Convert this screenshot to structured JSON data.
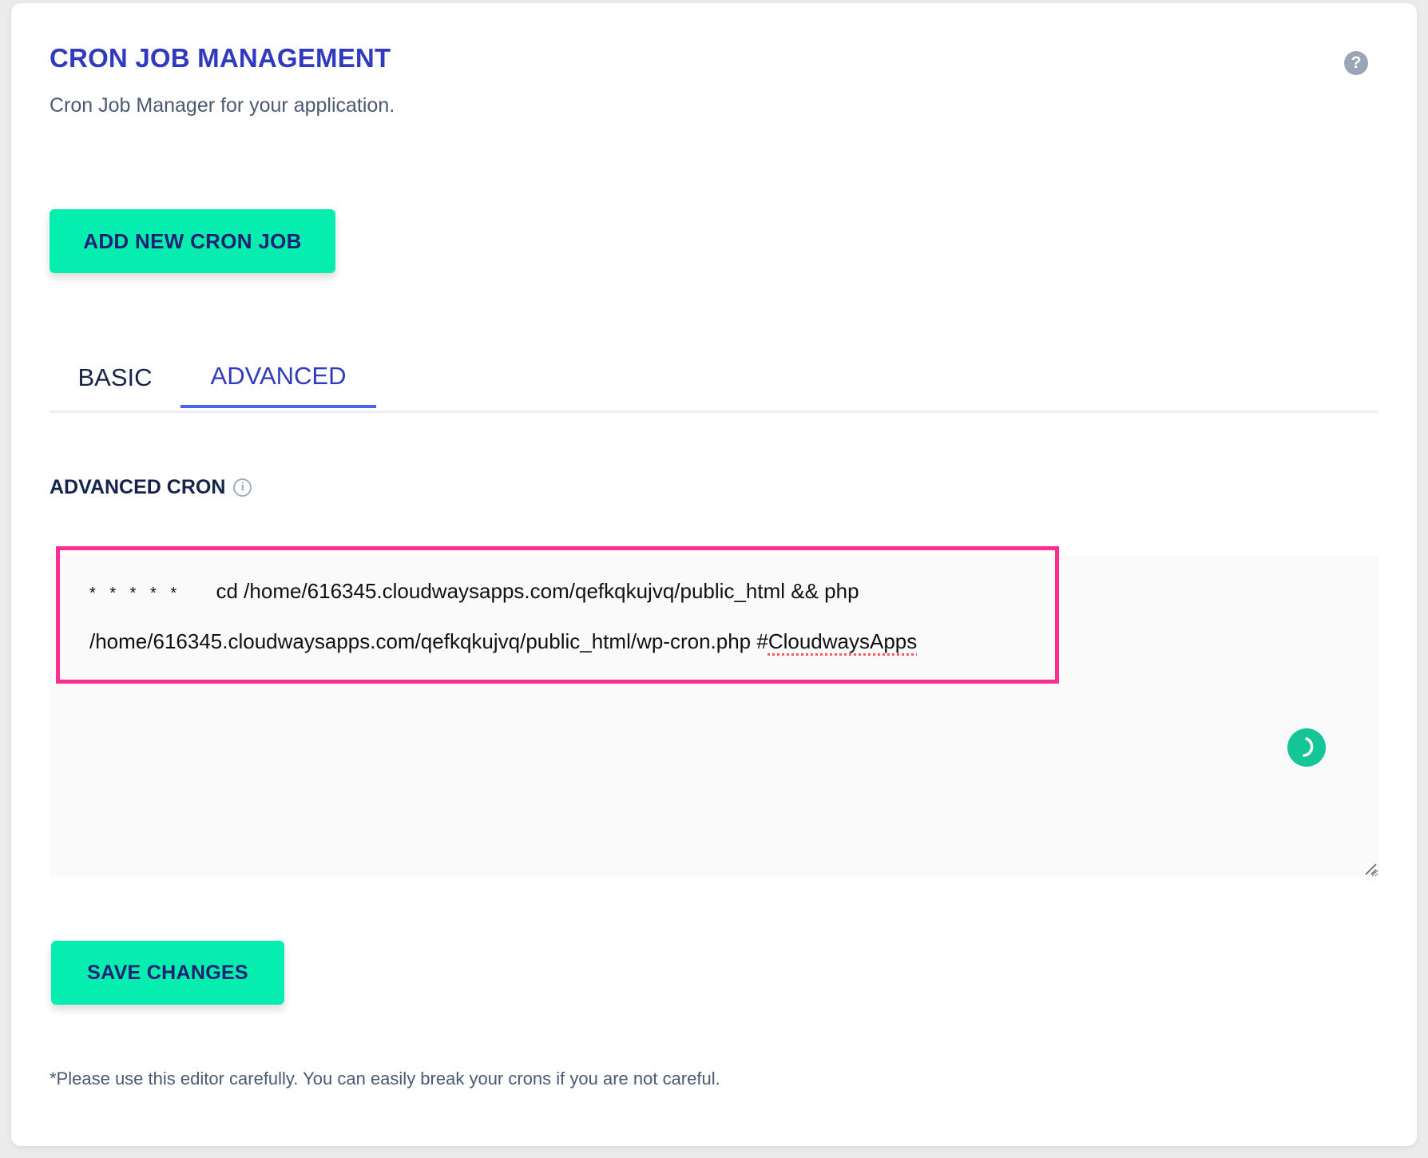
{
  "header": {
    "title": "CRON JOB MANAGEMENT",
    "subtitle": "Cron Job Manager for your application.",
    "help_icon": "question-circle-icon"
  },
  "actions": {
    "add_label": "ADD NEW CRON JOB",
    "save_label": "SAVE CHANGES"
  },
  "tabs": [
    {
      "label": "BASIC",
      "active": false
    },
    {
      "label": "ADVANCED",
      "active": true
    }
  ],
  "advanced": {
    "label": "ADVANCED CRON",
    "info_icon": "info-circle-icon",
    "editor": {
      "schedule": "* * * * *",
      "line1_command": "cd /home/616345.cloudwaysapps.com/qefkqkujvq/public_html && php",
      "line2_path": "/home/616345.cloudwaysapps.com/qefkqkujvq/public_html/wp-cron.php #",
      "line2_tag": "CloudwaysApps"
    }
  },
  "footnote": "*Please use this editor carefully. You can easily break your crons if you are not careful.",
  "colors": {
    "accent": "#2f3ac0",
    "button": "#06edb0",
    "button_text": "#1c2173",
    "tab_underline": "#4a63ef",
    "highlight": "#fe2d92",
    "spinner": "#14c596"
  }
}
